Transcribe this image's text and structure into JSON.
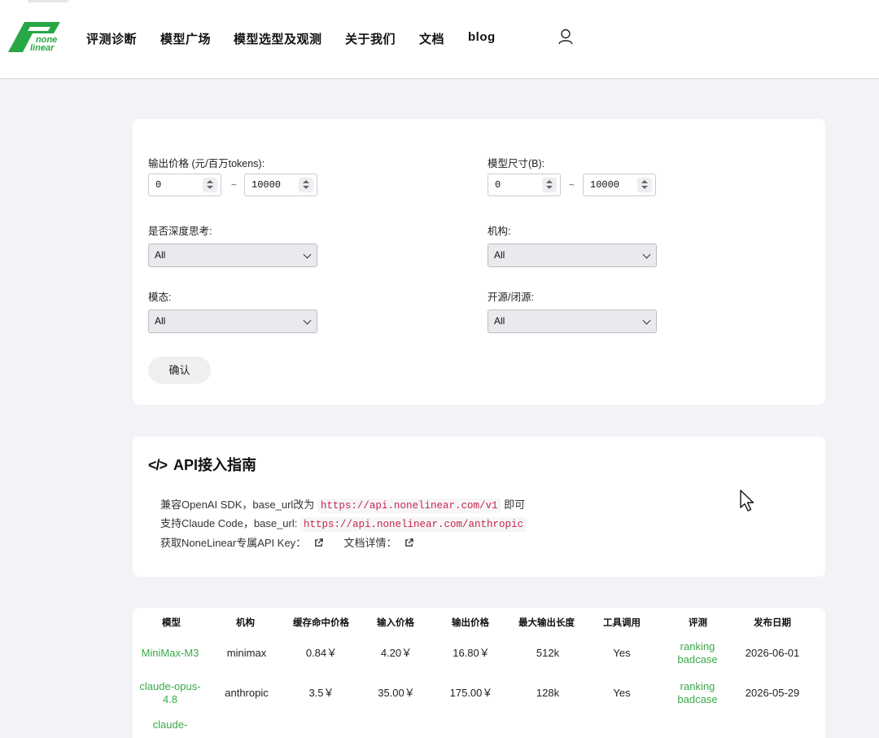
{
  "brand": {
    "line1": "none",
    "line2": "linear",
    "color": "#28a745"
  },
  "nav": {
    "items": [
      "评测诊断",
      "模型广场",
      "模型选型及观测",
      "关于我们",
      "文档",
      "blog"
    ]
  },
  "filters": {
    "price_label": "输出价格 (元/百万tokens):",
    "price_min": "0",
    "price_max": "10000",
    "size_label": "模型尺寸(B):",
    "size_min": "0",
    "size_max": "10000",
    "range_sep": "~",
    "thinking_label": "是否深度思考:",
    "thinking_value": "All",
    "org_label": "机构:",
    "org_value": "All",
    "modality_label": "模态:",
    "modality_value": "All",
    "opensource_label": "开源/闭源:",
    "opensource_value": "All",
    "confirm_label": "确认"
  },
  "api": {
    "icon": "</>",
    "title": "API接入指南",
    "openai_text": "兼容OpenAI SDK，base_url改为",
    "openai_url": "https://api.nonelinear.com/v1",
    "openai_suffix": "即可",
    "claude_text": "支持Claude Code，base_url:",
    "claude_url": "https://api.nonelinear.com/anthropic",
    "key_text": "获取NoneLinear专属API Key：",
    "docs_text": "文档详情："
  },
  "table": {
    "headers": [
      "模型",
      "机构",
      "缓存命中价格",
      "输入价格",
      "输出价格",
      "最大输出长度",
      "工具调用",
      "评测",
      "发布日期"
    ],
    "rows": [
      {
        "model": "MiniMax-M3",
        "org": "minimax",
        "cache": "0.84￥",
        "input": "4.20￥",
        "output": "16.80￥",
        "max_len": "512k",
        "tools": "Yes",
        "eval1": "ranking",
        "eval2": "badcase",
        "date": "2026-06-01"
      },
      {
        "model": "claude-opus-4.8",
        "org": "anthropic",
        "cache": "3.5￥",
        "input": "35.00￥",
        "output": "175.00￥",
        "max_len": "128k",
        "tools": "Yes",
        "eval1": "ranking",
        "eval2": "badcase",
        "date": "2026-05-29"
      },
      {
        "model": "claude-",
        "org": "",
        "cache": "",
        "input": "",
        "output": "",
        "max_len": "",
        "tools": "",
        "eval1": "",
        "eval2": "",
        "date": ""
      }
    ]
  }
}
